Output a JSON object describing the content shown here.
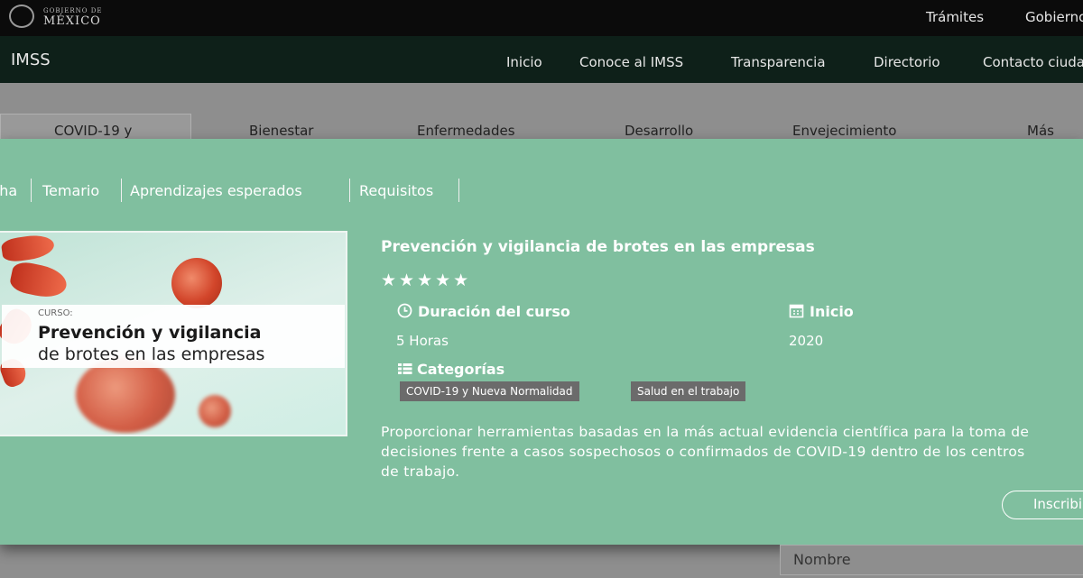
{
  "gov": {
    "small": "GOBIERNO DE",
    "big": "MÉXICO",
    "links": [
      "Trámites",
      "Gobierno"
    ]
  },
  "nav": {
    "brand": "IMSS",
    "links": [
      "Inicio",
      "Conoce al IMSS",
      "Transparencia",
      "Directorio",
      "Contacto ciudadano"
    ]
  },
  "bg_tabs": [
    "COVID-19 y",
    "Bienestar",
    "Enfermedades",
    "Desarrollo",
    "Envejecimiento",
    "Más"
  ],
  "modal": {
    "tabs": [
      "Ficha",
      "Temario",
      "Aprendizajes esperados",
      "Requisitos"
    ],
    "image": {
      "kicker": "CURSO:",
      "title_line1": "Prevención y vigilancia",
      "title_line2": "de brotes en las empresas"
    },
    "course_title": "Prevención y vigilancia de brotes en las empresas",
    "rating": {
      "stars": "★★★★★",
      "value": 5,
      "max": 5
    },
    "duration": {
      "label": "Duración del curso",
      "value": "5 Horas",
      "icon": "clock-icon"
    },
    "start": {
      "label": "Inicio",
      "value": "2020",
      "icon": "calendar-icon"
    },
    "categories": {
      "label": "Categorías",
      "icon": "list-icon",
      "items": [
        "COVID-19 y Nueva Normalidad",
        "Salud en el trabajo"
      ]
    },
    "description_lines": [
      "Proporcionar herramientas basadas en la más actual evidencia científica para la toma de",
      "decisiones frente a casos sospechosos o confirmados de COVID-19 dentro de los centros",
      "de trabajo."
    ],
    "enroll_label": "Inscribirse"
  },
  "form": {
    "name_placeholder": "Nombre"
  },
  "colors": {
    "govbar": "#0b0b0b",
    "navbar": "#0e2019",
    "modal": "#80bf9f",
    "overlay": "#8e8e8e",
    "badge": "#6b6b6b"
  }
}
